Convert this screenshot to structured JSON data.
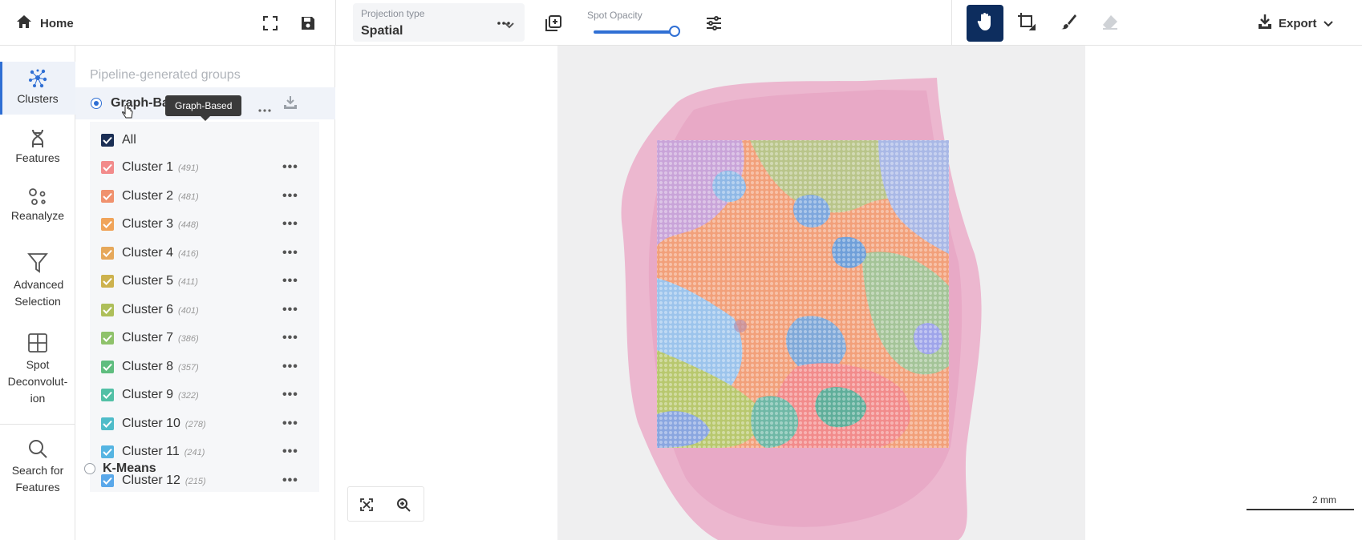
{
  "topbar": {
    "home_label": "Home",
    "projection_caption": "Projection type",
    "projection_value": "Spatial",
    "opacity_caption": "Spot Opacity",
    "opacity_level": 1.0,
    "export_label": "Export"
  },
  "leftnav": {
    "items": [
      {
        "label": "Clusters",
        "icon": "clusters-icon",
        "active": true
      },
      {
        "label": "Features",
        "icon": "dna-icon"
      },
      {
        "label": "Reanalyze",
        "icon": "reanalyze-icon"
      },
      {
        "label": "Advanced Selection",
        "icon": "filter-icon"
      },
      {
        "label": "Spot Deconvolut-ion",
        "icon": "grid-icon"
      },
      {
        "label": "Search for Features",
        "icon": "search-icon"
      }
    ]
  },
  "panel": {
    "section_title": "Pipeline-generated groups",
    "tooltip": "Graph-Based",
    "groups": [
      {
        "label": "Graph-Based",
        "selected": true
      },
      {
        "label": "K-Means",
        "selected": false
      }
    ],
    "all_label": "All",
    "clusters": [
      {
        "name": "Cluster 1",
        "count": "(491)",
        "color": "#f28b8b"
      },
      {
        "name": "Cluster 2",
        "count": "(481)",
        "color": "#f0916e"
      },
      {
        "name": "Cluster 3",
        "count": "(448)",
        "color": "#f0a45a"
      },
      {
        "name": "Cluster 4",
        "count": "(416)",
        "color": "#e6a85a"
      },
      {
        "name": "Cluster 5",
        "count": "(411)",
        "color": "#cdb24e"
      },
      {
        "name": "Cluster 6",
        "count": "(401)",
        "color": "#aebf5a"
      },
      {
        "name": "Cluster 7",
        "count": "(386)",
        "color": "#8fc26b"
      },
      {
        "name": "Cluster 8",
        "count": "(357)",
        "color": "#5fbd7f"
      },
      {
        "name": "Cluster 9",
        "count": "(322)",
        "color": "#52c0a6"
      },
      {
        "name": "Cluster 10",
        "count": "(278)",
        "color": "#4fbcc9"
      },
      {
        "name": "Cluster 11",
        "count": "(241)",
        "color": "#55b4e2"
      },
      {
        "name": "Cluster 12",
        "count": "(215)",
        "color": "#5aa8ea"
      }
    ]
  },
  "viewer": {
    "scale_label": "2 mm"
  },
  "colors": {
    "accent": "#2f6fd4",
    "active_tool": "#0d2d5e",
    "all_checkbox": "#1b2f55"
  }
}
